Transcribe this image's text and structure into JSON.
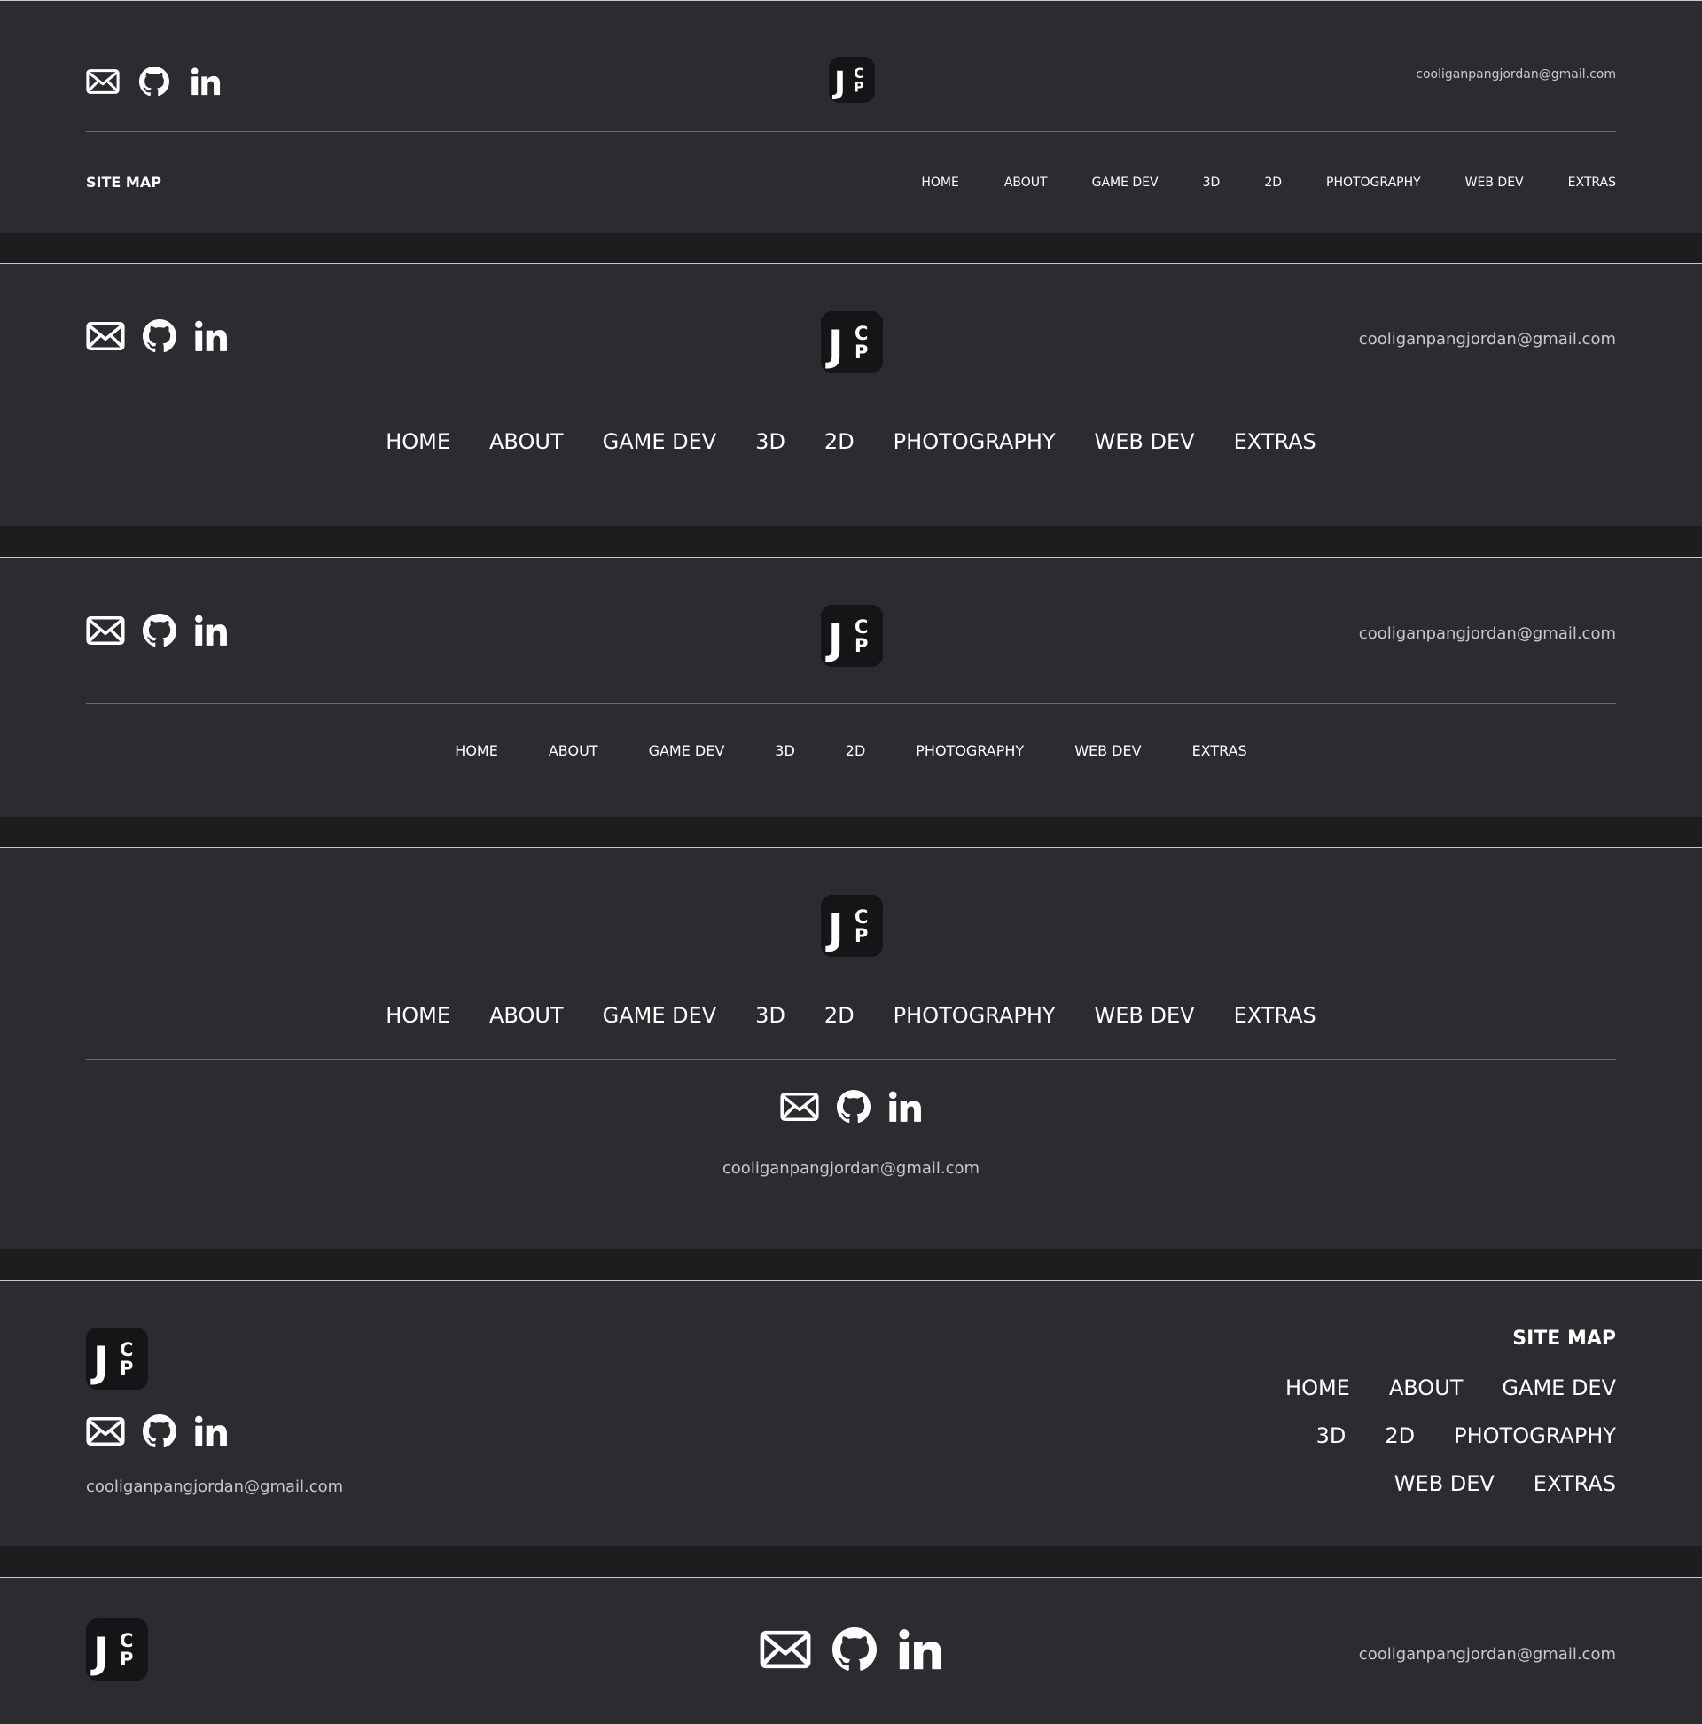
{
  "email": "cooliganpangjordan@gmail.com",
  "sitemap_title": "SITE MAP",
  "logo": {
    "letter_main": "J",
    "letter_top": "C",
    "letter_bottom": "P"
  },
  "icons": [
    "mail-icon",
    "github-icon",
    "linkedin-icon"
  ],
  "nav": {
    "home": "HOME",
    "about": "ABOUT",
    "gamedev": "GAME DEV",
    "3d": "3D",
    "2d": "2D",
    "photography": "PHOTOGRAPHY",
    "webdev": "WEB DEV",
    "extras": "EXTRAS"
  },
  "colors": {
    "panel": "#2b2c2f",
    "gap": "#1c1d1f",
    "logo_bg": "#141516",
    "text": "#ffffff",
    "muted": "#c8c9cb"
  }
}
